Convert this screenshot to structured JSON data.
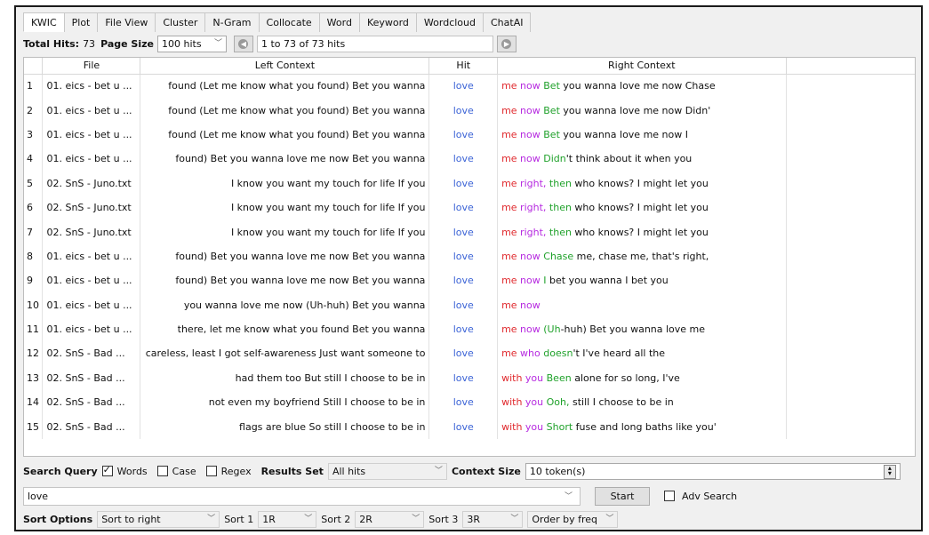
{
  "tabs": [
    "KWIC",
    "Plot",
    "File View",
    "Cluster",
    "N-Gram",
    "Collocate",
    "Word",
    "Keyword",
    "Wordcloud",
    "ChatAI"
  ],
  "active_tab": 0,
  "topbar": {
    "total_hits_label": "Total Hits:",
    "total_hits_value": "73",
    "page_size_label": "Page Size",
    "page_size_value": "100 hits",
    "range_text": "1 to 73 of 73 hits"
  },
  "table": {
    "headers": {
      "index": "",
      "file": "File",
      "left": "Left Context",
      "hit": "Hit",
      "right": "Right Context"
    },
    "rows": [
      {
        "n": "1",
        "file": "01. eics - bet u ...",
        "left": "found (Let me know what you found) Bet you wanna",
        "hit": "love",
        "right": [
          {
            "t": "me",
            "c": "red"
          },
          {
            "t": " now",
            "c": "pur"
          },
          {
            "t": " Bet",
            "c": "grn"
          },
          {
            "t": " you wanna love me now Chase",
            "c": "blk"
          }
        ]
      },
      {
        "n": "2",
        "file": "01. eics - bet u ...",
        "left": "found (Let me know what you found) Bet you wanna",
        "hit": "love",
        "right": [
          {
            "t": "me",
            "c": "red"
          },
          {
            "t": " now",
            "c": "pur"
          },
          {
            "t": " Bet",
            "c": "grn"
          },
          {
            "t": " you wanna love me now Didn'",
            "c": "blk"
          }
        ]
      },
      {
        "n": "3",
        "file": "01. eics - bet u ...",
        "left": "found (Let me know what you found) Bet you wanna",
        "hit": "love",
        "right": [
          {
            "t": "me",
            "c": "red"
          },
          {
            "t": " now",
            "c": "pur"
          },
          {
            "t": " Bet",
            "c": "grn"
          },
          {
            "t": " you wanna love me now I",
            "c": "blk"
          }
        ]
      },
      {
        "n": "4",
        "file": "01. eics - bet u ...",
        "left": "found) Bet you wanna love me now Bet you wanna",
        "hit": "love",
        "right": [
          {
            "t": "me",
            "c": "red"
          },
          {
            "t": " now",
            "c": "pur"
          },
          {
            "t": " Didn",
            "c": "grn"
          },
          {
            "t": "'t think about it when you",
            "c": "blk"
          }
        ]
      },
      {
        "n": "5",
        "file": "02. SnS - Juno.txt",
        "left": "I know you want my touch for life If you",
        "hit": "love",
        "right": [
          {
            "t": "me",
            "c": "red"
          },
          {
            "t": " right,",
            "c": "pur"
          },
          {
            "t": " then",
            "c": "grn"
          },
          {
            "t": " who knows? I might let you",
            "c": "blk"
          }
        ]
      },
      {
        "n": "6",
        "file": "02. SnS - Juno.txt",
        "left": "I know you want my touch for life If you",
        "hit": "love",
        "right": [
          {
            "t": "me",
            "c": "red"
          },
          {
            "t": " right,",
            "c": "pur"
          },
          {
            "t": " then",
            "c": "grn"
          },
          {
            "t": " who knows? I might let you",
            "c": "blk"
          }
        ]
      },
      {
        "n": "7",
        "file": "02. SnS - Juno.txt",
        "left": "I know you want my touch for life If you",
        "hit": "love",
        "right": [
          {
            "t": "me",
            "c": "red"
          },
          {
            "t": " right,",
            "c": "pur"
          },
          {
            "t": " then",
            "c": "grn"
          },
          {
            "t": " who knows? I might let you",
            "c": "blk"
          }
        ]
      },
      {
        "n": "8",
        "file": "01. eics - bet u ...",
        "left": "found) Bet you wanna love me now Bet you wanna",
        "hit": "love",
        "right": [
          {
            "t": "me",
            "c": "red"
          },
          {
            "t": " now",
            "c": "pur"
          },
          {
            "t": " Chase",
            "c": "grn"
          },
          {
            "t": " me, chase me, that's right,",
            "c": "blk"
          }
        ]
      },
      {
        "n": "9",
        "file": "01. eics - bet u ...",
        "left": "found) Bet you wanna love me now Bet you wanna",
        "hit": "love",
        "right": [
          {
            "t": "me",
            "c": "red"
          },
          {
            "t": " now",
            "c": "pur"
          },
          {
            "t": " I",
            "c": "grn"
          },
          {
            "t": " bet you wanna I bet you",
            "c": "blk"
          }
        ]
      },
      {
        "n": "10",
        "file": "01. eics - bet u ...",
        "left": "you wanna love me now (Uh-huh) Bet you wanna",
        "hit": "love",
        "right": [
          {
            "t": "me",
            "c": "red"
          },
          {
            "t": " now",
            "c": "pur"
          }
        ]
      },
      {
        "n": "11",
        "file": "01. eics - bet u ...",
        "left": "there, let me know what you found Bet you wanna",
        "hit": "love",
        "right": [
          {
            "t": "me",
            "c": "red"
          },
          {
            "t": " now",
            "c": "pur"
          },
          {
            "t": " (Uh",
            "c": "grn"
          },
          {
            "t": "-huh) Bet you wanna love me",
            "c": "blk"
          }
        ]
      },
      {
        "n": "12",
        "file": "02. SnS - Bad ...",
        "left": "careless, least I got self-awareness Just want someone to",
        "hit": "love",
        "right": [
          {
            "t": "me",
            "c": "red"
          },
          {
            "t": " who",
            "c": "pur"
          },
          {
            "t": " doesn",
            "c": "grn"
          },
          {
            "t": "'t I've heard all the",
            "c": "blk"
          }
        ]
      },
      {
        "n": "13",
        "file": "02. SnS - Bad ...",
        "left": "had them too But still I choose to be in",
        "hit": "love",
        "right": [
          {
            "t": "with",
            "c": "red"
          },
          {
            "t": " you",
            "c": "pur"
          },
          {
            "t": " Been",
            "c": "grn"
          },
          {
            "t": " alone for so long, I've",
            "c": "blk"
          }
        ]
      },
      {
        "n": "14",
        "file": "02. SnS - Bad ...",
        "left": "not even my boyfriend Still I choose to be in",
        "hit": "love",
        "right": [
          {
            "t": "with",
            "c": "red"
          },
          {
            "t": " you",
            "c": "pur"
          },
          {
            "t": " Ooh,",
            "c": "grn"
          },
          {
            "t": " still I choose to be in",
            "c": "blk"
          }
        ]
      },
      {
        "n": "15",
        "file": "02. SnS - Bad ...",
        "left": "flags are blue So still I choose to be in",
        "hit": "love",
        "right": [
          {
            "t": "with",
            "c": "red"
          },
          {
            "t": " you",
            "c": "pur"
          },
          {
            "t": " Short",
            "c": "grn"
          },
          {
            "t": " fuse and long baths like you'",
            "c": "blk"
          }
        ]
      }
    ]
  },
  "search": {
    "query_label": "Search Query",
    "words_label": "Words",
    "words_checked": true,
    "case_label": "Case",
    "case_checked": false,
    "regex_label": "Regex",
    "regex_checked": false,
    "results_set_label": "Results Set",
    "results_set_value": "All hits",
    "context_size_label": "Context Size",
    "context_size_value": "10 token(s)",
    "query_value": "love",
    "start_label": "Start",
    "adv_search_label": "Adv Search",
    "adv_search_checked": false
  },
  "sort": {
    "options_label": "Sort Options",
    "options_value": "Sort to right",
    "sort1_label": "Sort 1",
    "sort1_value": "1R",
    "sort2_label": "Sort 2",
    "sort2_value": "2R",
    "sort3_label": "Sort 3",
    "sort3_value": "3R",
    "order_value": "Order by freq"
  },
  "colors": {
    "red": "#e0292d",
    "purple": "#b62ae0",
    "green": "#1fa12a",
    "hit": "#3b63d6"
  },
  "icons": {
    "prev": "prev-page-icon",
    "next": "next-page-icon",
    "dropdown": "chevron-down-icon",
    "spinner": "spinner-icon"
  }
}
